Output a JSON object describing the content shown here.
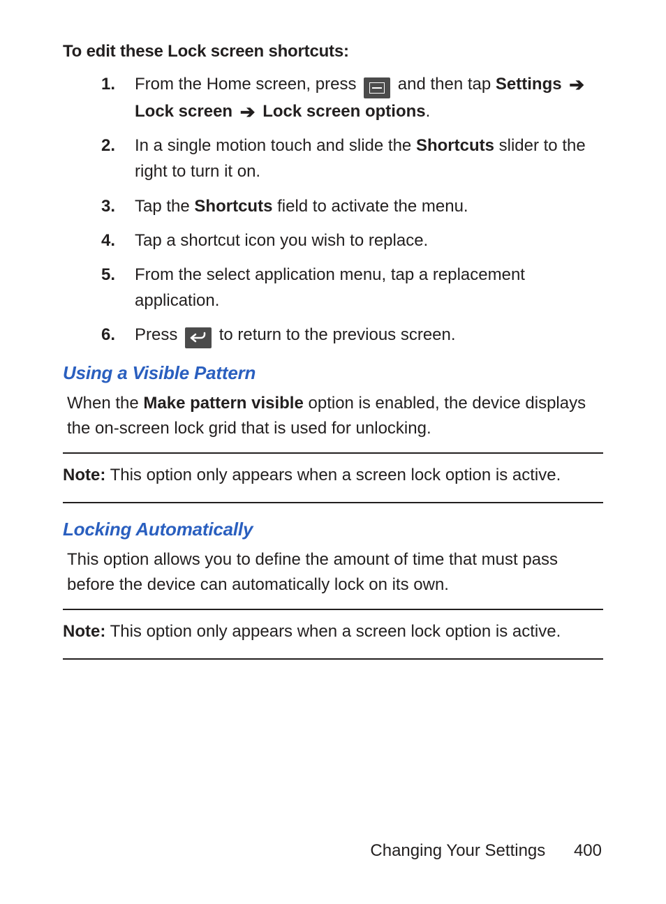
{
  "intro": "To edit these Lock screen shortcuts:",
  "steps": {
    "s1_a": "From the Home screen, press ",
    "s1_b": " and then tap ",
    "s1_settings": "Settings",
    "s1_lockscreen": "Lock screen",
    "s1_lockscreen_options": "Lock screen options",
    "s1_period": ".",
    "s2_a": "In a single motion touch and slide the ",
    "s2_shortcuts": "Shortcuts",
    "s2_b": " slider to the right to turn it on.",
    "s3_a": "Tap the ",
    "s3_shortcuts": "Shortcuts",
    "s3_b": " field to activate the menu.",
    "s4": "Tap a shortcut icon you wish to replace.",
    "s5": "From the select application menu, tap a replacement application.",
    "s6_a": "Press ",
    "s6_b": " to return to the previous screen."
  },
  "visible_pattern": {
    "heading": "Using a Visible Pattern",
    "body_a": "When the ",
    "body_bold": "Make pattern visible",
    "body_b": " option is enabled, the device displays the on-screen lock grid that is used for unlocking.",
    "note_label": "Note:",
    "note_text": " This option only appears when a screen lock option is active."
  },
  "locking_auto": {
    "heading": "Locking Automatically",
    "body": "This option allows you to define the amount of time that must pass before the device can automatically lock on its own.",
    "note_label": "Note:",
    "note_text": " This option only appears when a screen lock option is active."
  },
  "footer": {
    "chapter": "Changing Your Settings",
    "page": "400"
  }
}
